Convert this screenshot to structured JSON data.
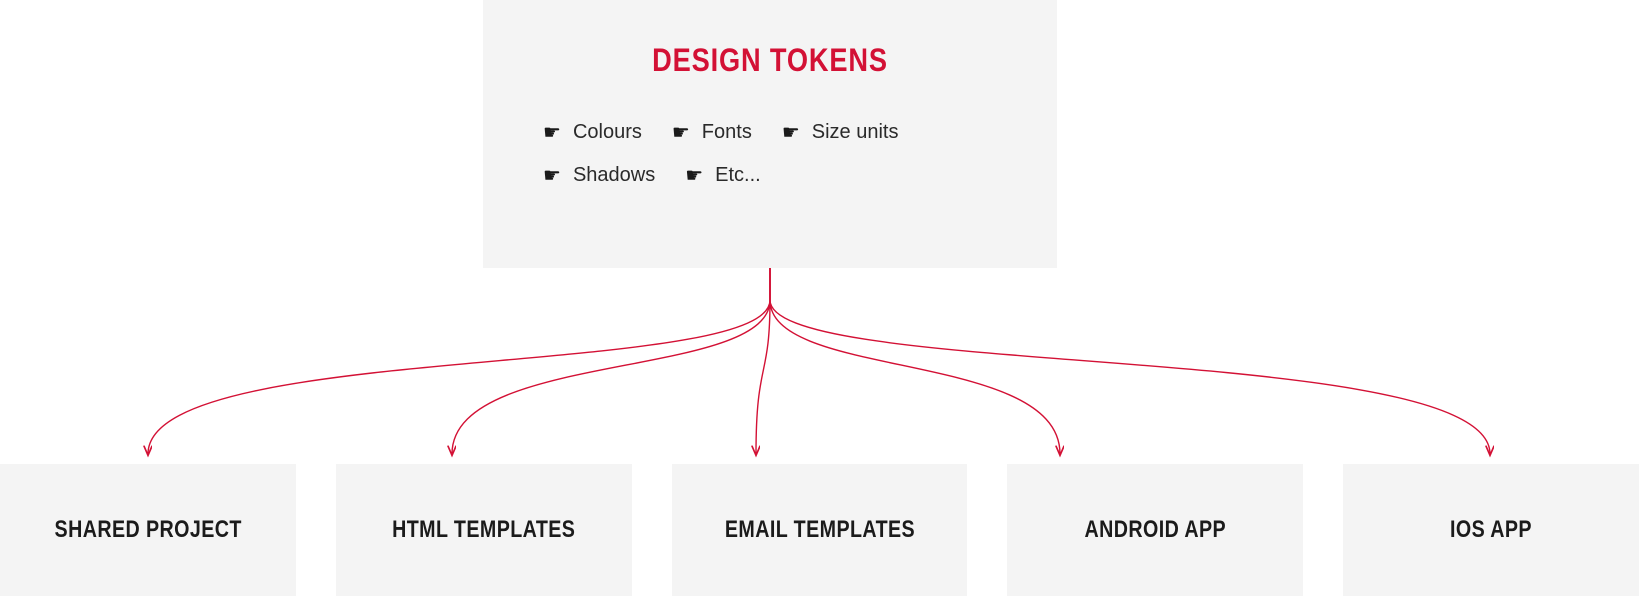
{
  "source": {
    "title": "DESIGN TOKENS",
    "items": [
      {
        "label": "Colours"
      },
      {
        "label": "Fonts"
      },
      {
        "label": "Size units"
      },
      {
        "label": "Shadows"
      },
      {
        "label": "Etc..."
      }
    ]
  },
  "targets": [
    {
      "label": "SHARED PROJECT"
    },
    {
      "label": "HTML TEMPLATES"
    },
    {
      "label": "EMAIL TEMPLATES"
    },
    {
      "label": "ANDROID APP"
    },
    {
      "label": "IOS APP"
    }
  ],
  "colors": {
    "accent": "#d31135",
    "box_bg": "#f4f4f4",
    "text_dark": "#1b1b1b"
  }
}
